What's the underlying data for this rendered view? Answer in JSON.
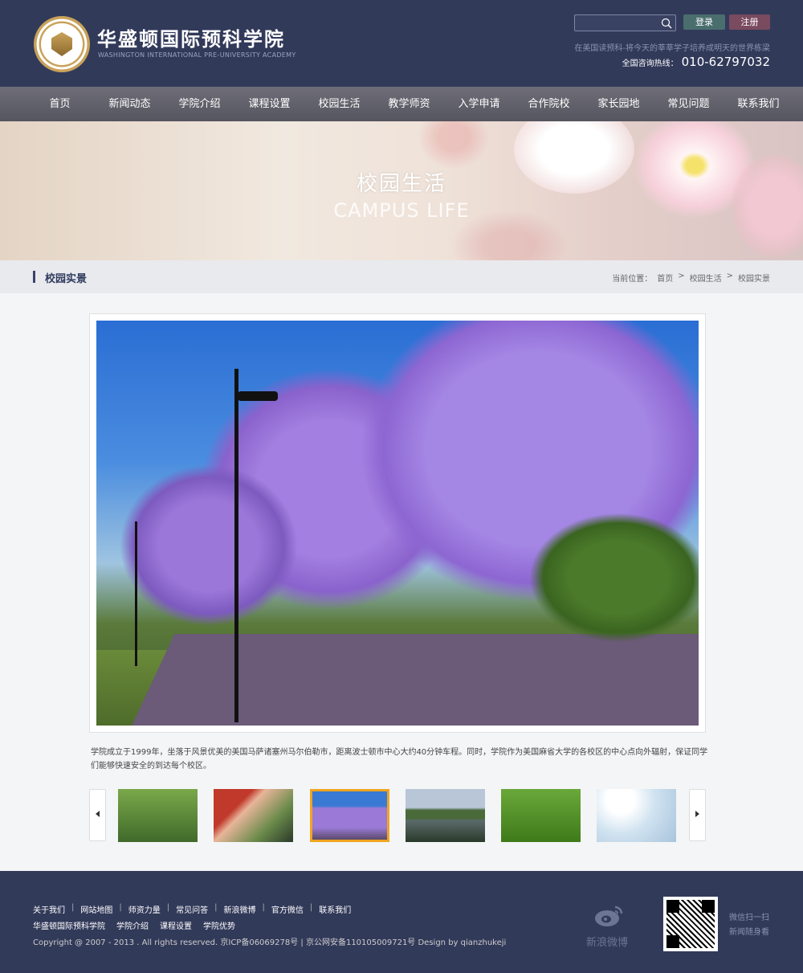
{
  "header": {
    "logo_cn": "华盛顿国际预科学院",
    "logo_en": "WASHINGTON INTERNATIONAL PRE-UNIVERSITY ACADEMY",
    "search_placeholder": "",
    "login_label": "登录",
    "register_label": "注册",
    "slogan": "在美国读预科-将今天的莘莘学子培养成明天的世界栋梁",
    "hotline_label": "全国咨询热线：",
    "hotline_number": "010-62797032"
  },
  "nav": {
    "items": [
      "首页",
      "新闻动态",
      "学院介绍",
      "课程设置",
      "校园生活",
      "教学师资",
      "入学申请",
      "合作院校",
      "家长园地",
      "常见问题",
      "联系我们"
    ]
  },
  "banner": {
    "title_cn": "校园生活",
    "title_en": "CAMPUS LIFE"
  },
  "subheader": {
    "title": "校园实景",
    "breadcrumb_label": "当前位置：",
    "breadcrumb": [
      "首页",
      "校园生活",
      "校园实景"
    ]
  },
  "main": {
    "description": "学院成立于1999年，坐落于风景优美的美国马萨诸塞州马尔伯勒市，距离波士顿市中心大约40分钟车程。同时，学院作为美国麻省大学的各校区的中心点向外辐射，保证同学们能够快速安全的到达每个校区。"
  },
  "footer": {
    "links": [
      "关于我们",
      "网站地图",
      "师资力量",
      "常见问答",
      "新浪微博",
      "官方微信",
      "联系我们"
    ],
    "links2": [
      "华盛顿国际预科学院",
      "学院介绍",
      "课程设置",
      "学院优势"
    ],
    "copyright": "Copyright @ 2007 - 2013   . All rights reserved.   京ICP备06069278号 | 京公网安备110105009721号  Design by qianzhukeji",
    "weibo_label": "新浪微博",
    "qr_line1": "微信扫一扫",
    "qr_line2": "新闻随身看"
  },
  "colors": {
    "header_bg": "#323a5a",
    "thumb_active_border": "#f0a520"
  }
}
